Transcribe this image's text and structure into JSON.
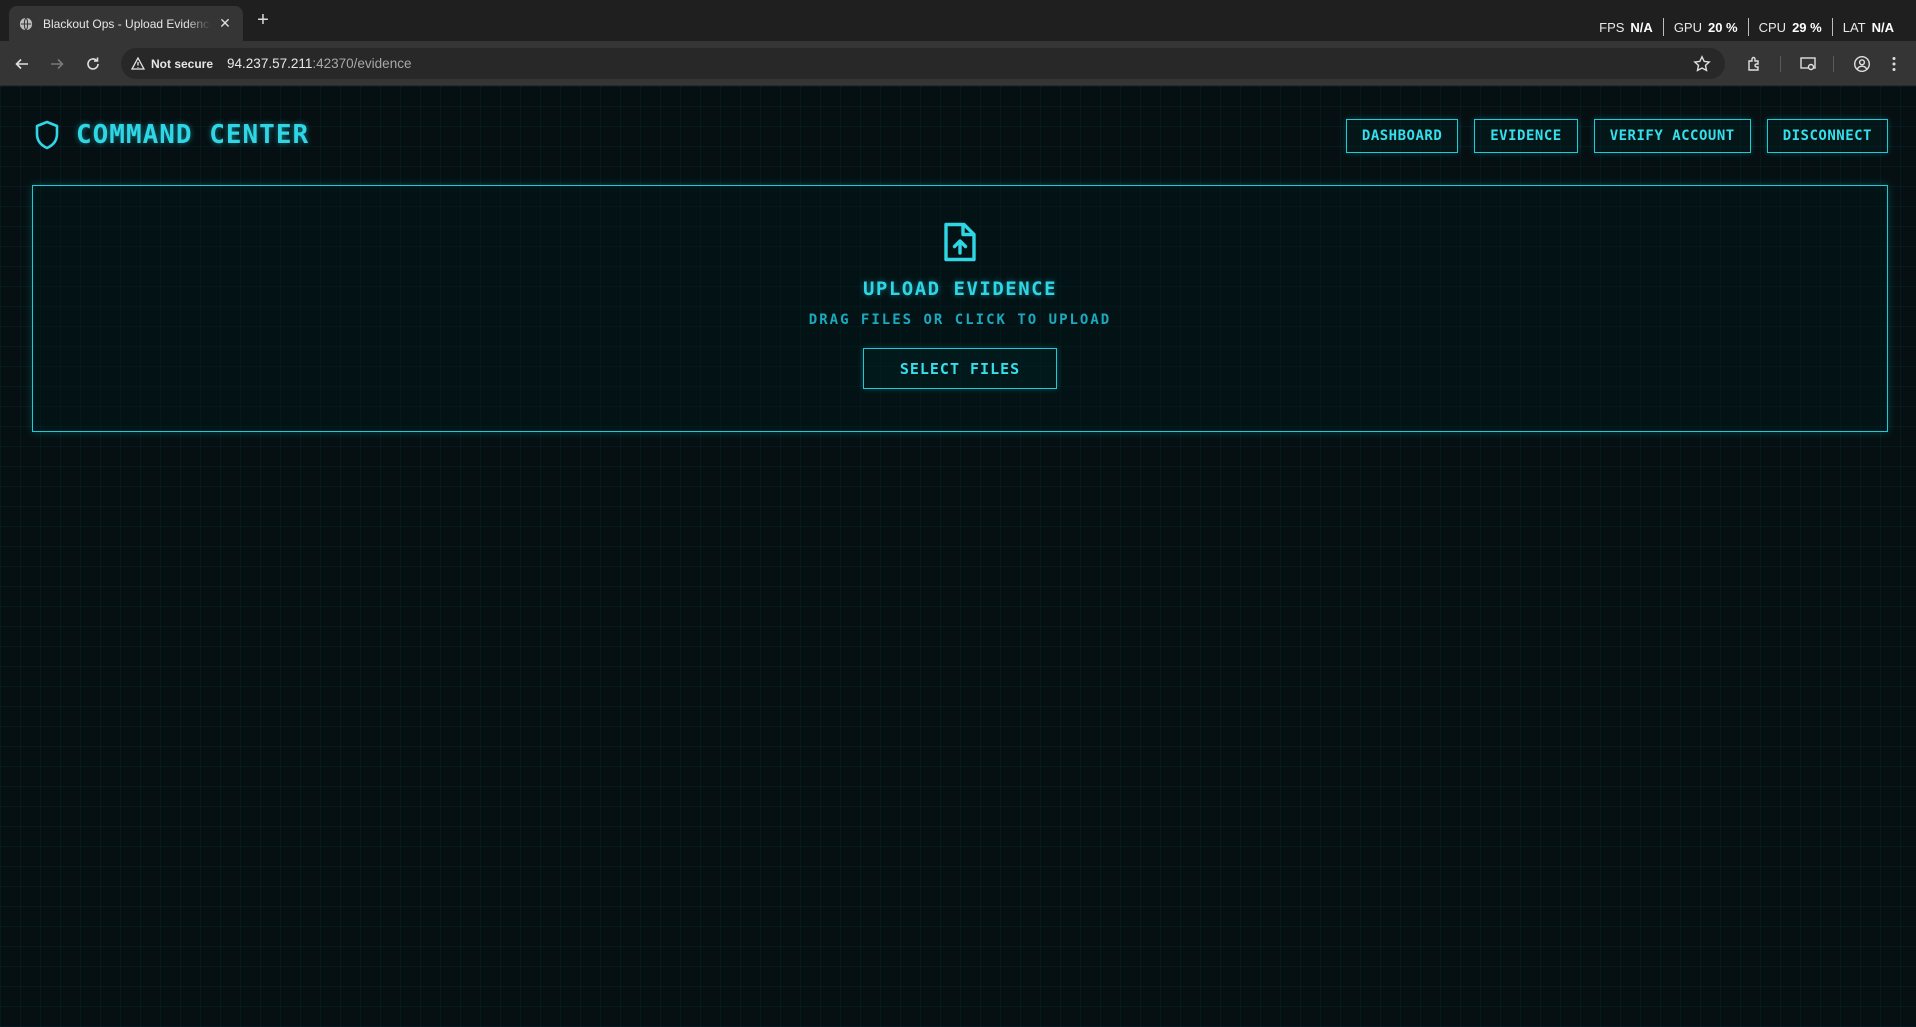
{
  "browser": {
    "tab": {
      "title": "Blackout Ops - Upload Evidence"
    },
    "security_label": "Not secure",
    "url_host": "94.237.57.211",
    "url_path": ":42370/evidence",
    "perf": [
      {
        "label": "FPS",
        "value": "N/A"
      },
      {
        "label": "GPU",
        "value": "20 %"
      },
      {
        "label": "CPU",
        "value": "29 %"
      },
      {
        "label": "LAT",
        "value": "N/A"
      }
    ]
  },
  "header": {
    "brand": "COMMAND CENTER",
    "nav": [
      "DASHBOARD",
      "EVIDENCE",
      "VERIFY ACCOUNT",
      "DISCONNECT"
    ]
  },
  "upload": {
    "title": "UPLOAD EVIDENCE",
    "subtitle": "DRAG FILES OR CLICK TO UPLOAD",
    "button": "SELECT FILES"
  },
  "colors": {
    "accent": "#2fd6e6",
    "background": "#061012",
    "chrome_dark": "#1f1f1f",
    "chrome_toolbar": "#353535"
  }
}
